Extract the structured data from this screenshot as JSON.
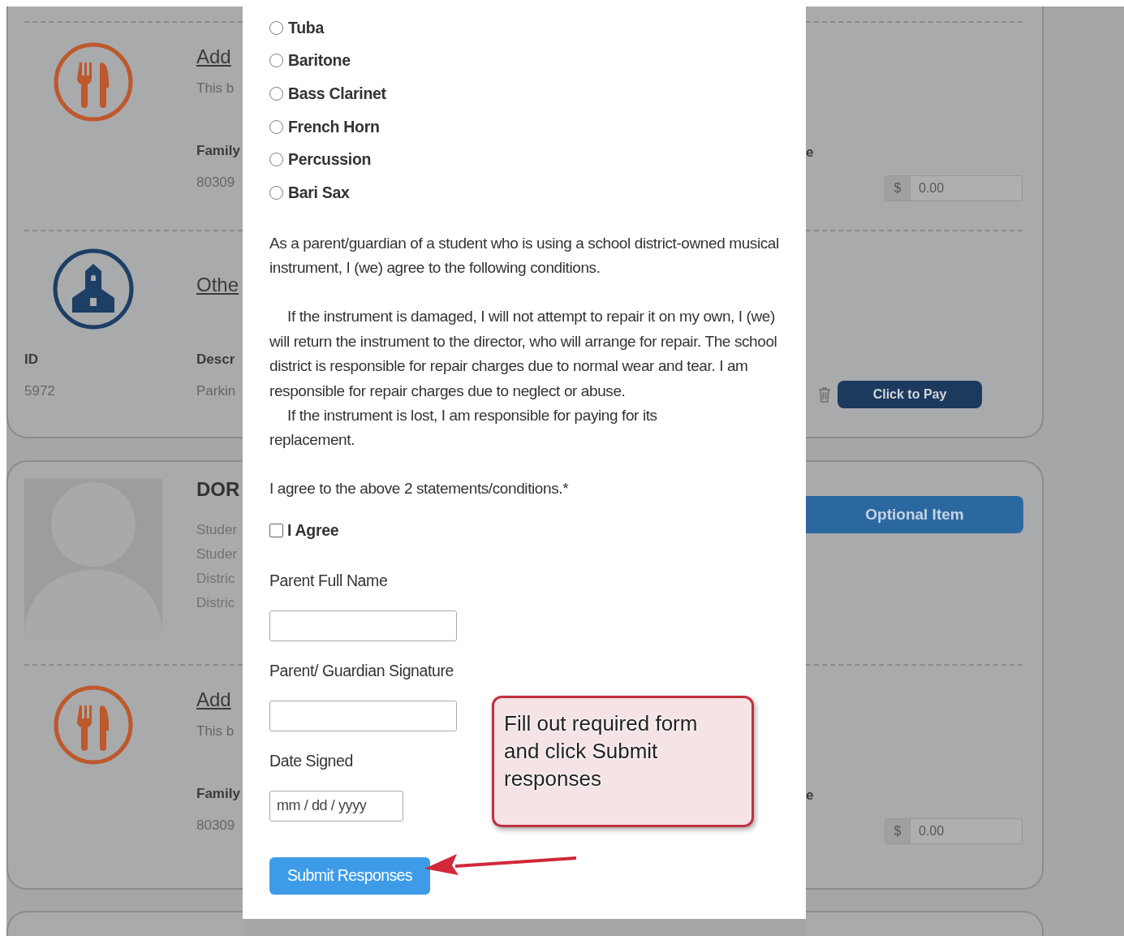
{
  "background_page": {
    "cards": [
      {
        "sections": [
          {
            "kind": "meal",
            "title": "Add",
            "note": "This b",
            "field_label": "Family",
            "field_value": "80309",
            "right_label": "e",
            "amount_prefix": "$",
            "amount": "0.00"
          },
          {
            "kind": "school",
            "title": "Othe",
            "columns": [
              {
                "label": "ID",
                "value": "5972"
              },
              {
                "label": "Descr",
                "value": "Parkin"
              }
            ],
            "pay_button": "Click to Pay"
          }
        ]
      },
      {
        "sections": [
          {
            "kind": "student",
            "name": "DOR",
            "lines": [
              "Studer",
              "Studer",
              "Distric",
              "Distric"
            ],
            "button": "Optional Item"
          },
          {
            "kind": "meal",
            "title": "Add",
            "note": "This b",
            "field_label": "Family",
            "field_value": "80309",
            "right_label": "e",
            "amount_prefix": "$",
            "amount": "0.00"
          }
        ]
      }
    ]
  },
  "form": {
    "instrument_options": [
      {
        "label": "Tuba",
        "selected": false
      },
      {
        "label": "Baritone",
        "selected": false
      },
      {
        "label": "Bass Clarinet",
        "selected": false
      },
      {
        "label": "French Horn",
        "selected": false
      },
      {
        "label": "Percussion",
        "selected": false
      },
      {
        "label": "Bari Sax",
        "selected": false
      }
    ],
    "intro": "As a parent/guardian of a student who is using a school district-owned musical instrument, I (we) agree to the following conditions.",
    "statements": [
      "If the instrument is damaged, I will not attempt to repair it on my own, I (we) will return the instrument to the director, who will arrange for repair. The school district is responsible for repair charges due to normal wear and tear. I am responsible for repair charges due to neglect or abuse.",
      "If the instrument is lost, I am responsible for paying for its replacement."
    ],
    "prompt": "I agree to the above 2 statements/conditions.*",
    "agree": {
      "label": "I Agree",
      "checked": false
    },
    "fields": [
      {
        "kind": "text",
        "label": "Parent Full Name"
      },
      {
        "kind": "text",
        "label": "Parent/ Guardian Signature"
      },
      {
        "kind": "date",
        "label": "Date Signed",
        "placeholder": "mm / dd / yyyy"
      }
    ],
    "submit_button": "Submit Responses"
  },
  "callout": {
    "text": "Fill out required form and click Submit responses"
  }
}
